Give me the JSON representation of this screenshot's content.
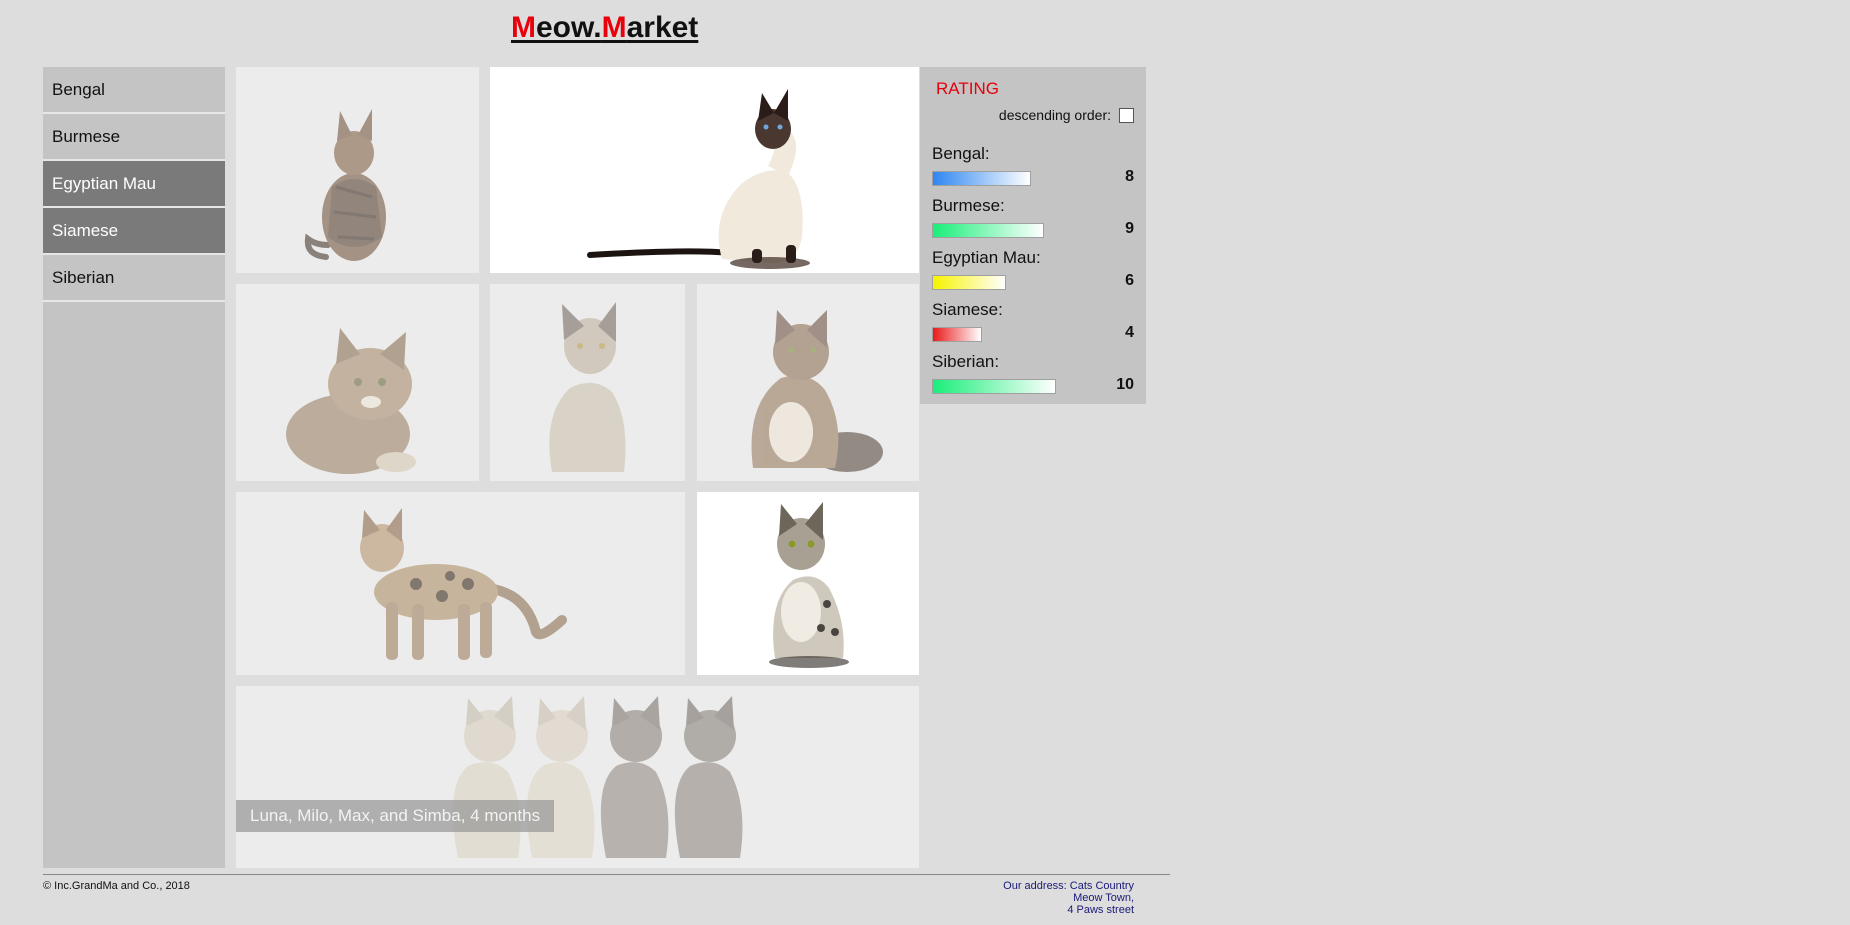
{
  "header": {
    "logo_m1": "M",
    "logo_part1": "eow.",
    "logo_m2": "M",
    "logo_part2": "arket",
    "brand_color": "#e8000b"
  },
  "sidebar": {
    "items": [
      {
        "label": "Bengal",
        "active": false
      },
      {
        "label": "Burmese",
        "active": false
      },
      {
        "label": "Egyptian Mau",
        "active": true
      },
      {
        "label": "Siamese",
        "active": true
      },
      {
        "label": "Siberian",
        "active": false
      }
    ]
  },
  "gallery": {
    "caption": "Luna, Milo, Max, and Simba, 4 months"
  },
  "rating": {
    "title": "RATING",
    "order_label": "descending order:",
    "descending_checked": false,
    "items": [
      {
        "name": "Bengal:",
        "score": "8",
        "value": 8,
        "color": "#2f86f0"
      },
      {
        "name": "Burmese:",
        "score": "9",
        "value": 9,
        "color": "#1aee7a"
      },
      {
        "name": "Egyptian Mau:",
        "score": "6",
        "value": 6,
        "color": "#f7f300"
      },
      {
        "name": "Siamese:",
        "score": "4",
        "value": 4,
        "color": "#ea1a1a"
      },
      {
        "name": "Siberian:",
        "score": "10",
        "value": 10,
        "color": "#1aee7a"
      }
    ]
  },
  "footer": {
    "copyright": "© Inc.GrandMa and Co., 2018",
    "address_line1": "Our address: Cats Country",
    "address_line2": "Meow Town,",
    "address_line3": "4 Paws street"
  }
}
